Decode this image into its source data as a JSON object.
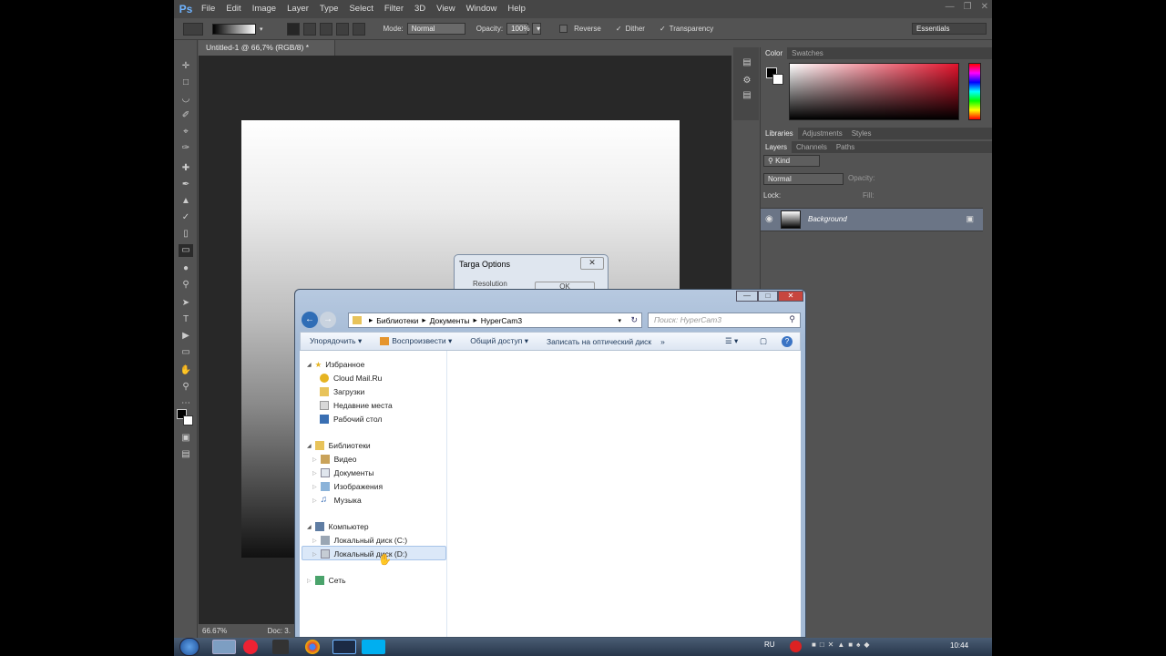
{
  "photoshop": {
    "logo": "Ps",
    "menu": [
      "File",
      "Edit",
      "Image",
      "Layer",
      "Type",
      "Select",
      "Filter",
      "3D",
      "View",
      "Window",
      "Help"
    ],
    "options": {
      "mode_label": "Mode:",
      "mode_value": "Normal",
      "opacity_label": "Opacity:",
      "opacity_value": "100%",
      "reverse_label": "Reverse",
      "dither_label": "Dither",
      "transparency_label": "Transparency",
      "workspace": "Essentials"
    },
    "document_tab": "Untitled-1 @ 66,7% (RGB/8) *",
    "status": {
      "zoom": "66.67%",
      "doc": "Doc: 3."
    },
    "panels": {
      "color_tabs": [
        "Color",
        "Swatches"
      ],
      "lib_tabs": [
        "Libraries",
        "Adjustments",
        "Styles"
      ],
      "layer_tabs": [
        "Layers",
        "Channels",
        "Paths"
      ],
      "kind_label": "Kind",
      "blend_mode": "Normal",
      "opacity_label": "Opacity:",
      "lock_label": "Lock:",
      "fill_label": "Fill:",
      "layer_name": "Background",
      "colors": {
        "accent": "#e3132c",
        "selected_layer": "#6b7586"
      }
    }
  },
  "targa_dialog": {
    "title": "Targa Options",
    "resolution_label": "Resolution",
    "ok_label": "OK"
  },
  "explorer": {
    "breadcrumb": [
      "Библиотеки",
      "Документы",
      "HyperCam3"
    ],
    "search_placeholder": "Поиск: HyperCam3",
    "commands": [
      "Упорядочить",
      "Воспроизвести",
      "Общий доступ",
      "Записать на оптический диск"
    ],
    "nav": {
      "favorites_header": "Избранное",
      "favorites": [
        "Cloud Mail.Ru",
        "Загрузки",
        "Недавние места",
        "Рабочий стол"
      ],
      "libraries_header": "Библиотеки",
      "libraries": [
        "Видео",
        "Документы",
        "Изображения",
        "Музыка"
      ],
      "computer_header": "Компьютер",
      "drives": [
        "Локальный диск (C:)",
        "Локальный диск (D:)"
      ],
      "network": "Сеть"
    }
  },
  "taskbar": {
    "language": "RU",
    "time": "10:44"
  }
}
